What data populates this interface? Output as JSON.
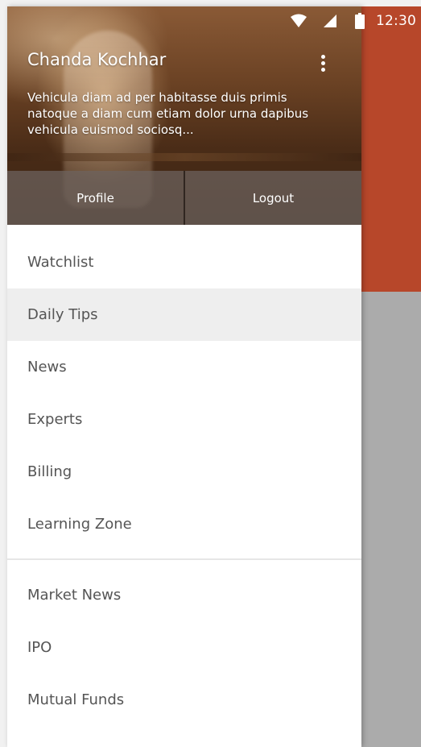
{
  "status_bar": {
    "time": "12:30",
    "icons": [
      "wifi-icon",
      "signal-icon",
      "battery-icon"
    ]
  },
  "colors": {
    "toolbar": "#b7472a",
    "scrim": "#ababab",
    "selected_row": "#eeeeee",
    "menu_text": "#555555"
  },
  "drawer": {
    "header": {
      "name": "Chanda Kochhar",
      "bio": "Vehicula diam ad per habitasse duis primis natoque a diam cum etiam dolor urna dapibus vehicula euismod sociosq...",
      "profile_label": "Profile",
      "logout_label": "Logout"
    },
    "primary_items": [
      {
        "label": "Watchlist"
      },
      {
        "label": "Daily Tips",
        "selected": true
      },
      {
        "label": "News"
      },
      {
        "label": "Experts"
      },
      {
        "label": "Billing"
      },
      {
        "label": "Learning Zone"
      }
    ],
    "secondary_items": [
      {
        "label": "Market News"
      },
      {
        "label": "IPO"
      },
      {
        "label": "Mutual Funds"
      }
    ]
  }
}
